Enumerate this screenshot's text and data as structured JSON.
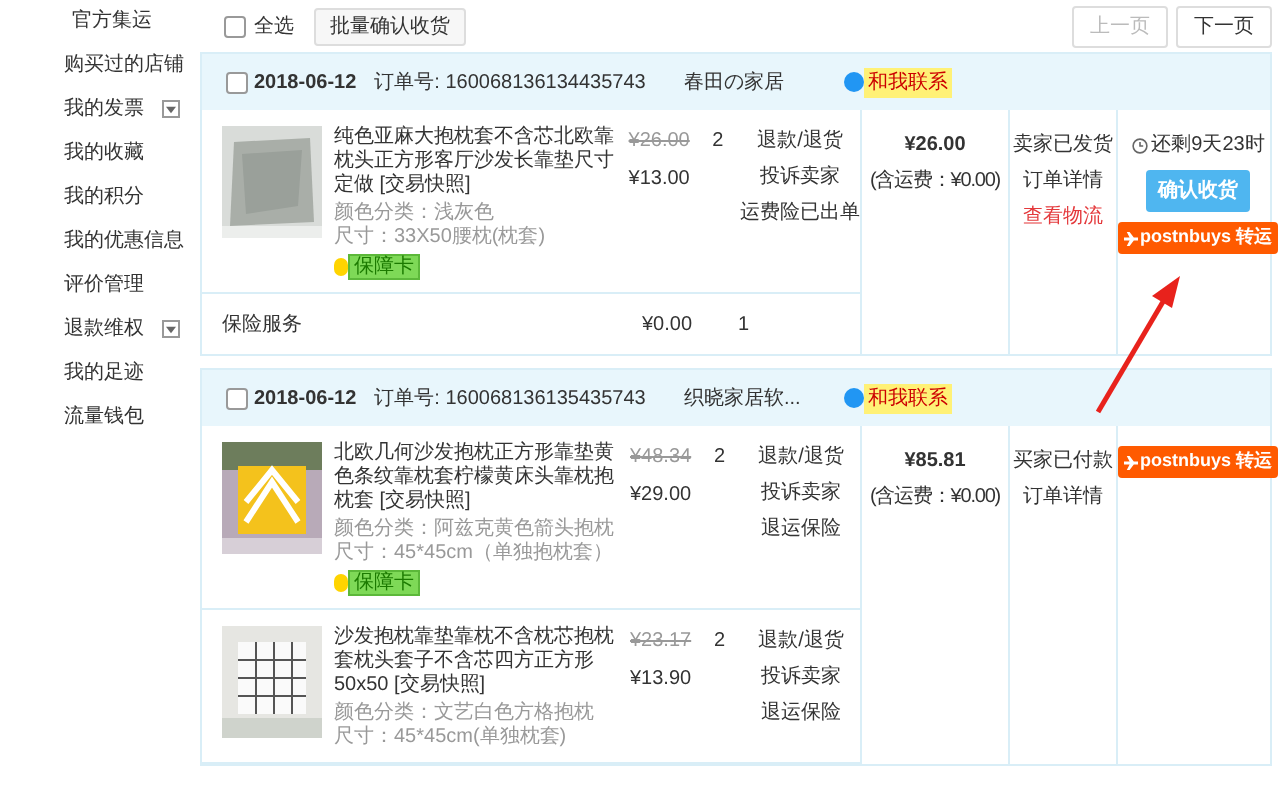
{
  "sidebar": {
    "items": [
      {
        "label": "官方集运",
        "expandable": false
      },
      {
        "label": "购买过的店铺",
        "expandable": false
      },
      {
        "label": "我的发票",
        "expandable": true
      },
      {
        "label": "我的收藏",
        "expandable": false
      },
      {
        "label": "我的积分",
        "expandable": false
      },
      {
        "label": "我的优惠信息",
        "expandable": false
      },
      {
        "label": "评价管理",
        "expandable": false
      },
      {
        "label": "退款维权",
        "expandable": true
      },
      {
        "label": "我的足迹",
        "expandable": false
      },
      {
        "label": "流量钱包",
        "expandable": false
      }
    ]
  },
  "toolbar": {
    "select_all": {
      "label": "全选",
      "checked": false
    },
    "bulk_button": "批量确认收货",
    "prev_button": {
      "label": "上一页",
      "disabled": true
    },
    "next_button": {
      "label": "下一页",
      "disabled": false
    }
  },
  "orders": [
    {
      "checked": false,
      "date": "2018-06-12",
      "order_no": "订单号: 160068136134435743",
      "shop": "春田の家居",
      "contact": "和我联系",
      "items": [
        {
          "kind": "picture",
          "title": "纯色亚麻大抱枕套不含芯北欧靠枕头正方形客厅沙发长靠垫尺寸定做 [交易快照]",
          "variant": "颜色分类：浅灰色",
          "size": "尺寸：33X50腰枕(枕套)",
          "badge": "保障卡",
          "original_price": "¥26.00",
          "price": "¥13.00",
          "qty": "2",
          "actions": [
            "退款/退货",
            "投诉卖家",
            "运费险已出单"
          ]
        }
      ],
      "service": {
        "label": "保险服务",
        "price": "¥0.00",
        "qty": "1"
      },
      "total": "¥26.00",
      "shipping": "(含运费：¥0.00)",
      "status": [
        {
          "text": "卖家已发货",
          "kind": "plain"
        },
        {
          "text": "订单详情",
          "kind": "plain"
        },
        {
          "text": "查看物流",
          "kind": "link"
        }
      ],
      "countdown": "还剩9天23时",
      "buttons": [
        {
          "label": "确认收货",
          "kind": "confirm"
        },
        {
          "label": "postnbuys 转运",
          "kind": "forward"
        }
      ]
    },
    {
      "checked": false,
      "date": "2018-06-12",
      "order_no": "订单号: 160068136135435743",
      "shop": "织晓家居软...",
      "contact": "和我联系",
      "items": [
        {
          "kind": "picture",
          "title": "北欧几何沙发抱枕正方形靠垫黄色条纹靠枕套柠檬黄床头靠枕抱枕套 [交易快照]",
          "variant": "颜色分类：阿兹克黄色箭头抱枕",
          "size": "尺寸：45*45cm（单独抱枕套）",
          "badge": "保障卡",
          "original_price": "¥48.34",
          "price": "¥29.00",
          "qty": "2",
          "actions": [
            "退款/退货",
            "投诉卖家",
            "退运保险"
          ]
        },
        {
          "kind": "picture",
          "title": "沙发抱枕靠垫靠枕不含枕芯抱枕套枕头套子不含芯四方正方形50x50 [交易快照]",
          "variant": "颜色分类：文艺白色方格抱枕",
          "size": "尺寸：45*45cm(单独枕套)",
          "original_price": "¥23.17",
          "price": "¥13.90",
          "qty": "2",
          "actions": [
            "退款/退货",
            "投诉卖家",
            "退运保险"
          ]
        }
      ],
      "total": "¥85.81",
      "shipping": "(含运费：¥0.00)",
      "status": [
        {
          "text": "买家已付款",
          "kind": "plain"
        },
        {
          "text": "订单详情",
          "kind": "plain"
        }
      ],
      "buttons": [
        {
          "label": "postnbuys 转运",
          "kind": "forward"
        }
      ]
    }
  ]
}
